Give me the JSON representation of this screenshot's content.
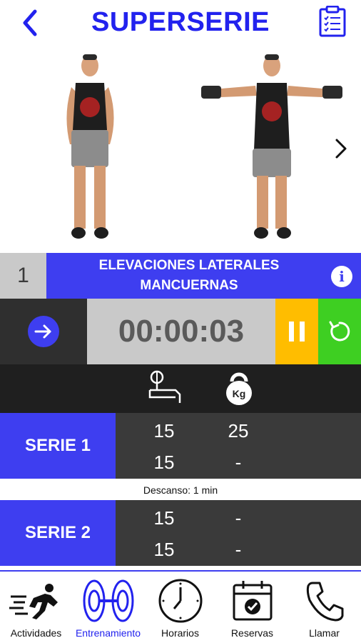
{
  "header": {
    "title": "SUPERSERIE",
    "back_icon": "chevron-left-icon",
    "clipboard_icon": "clipboard-list-icon"
  },
  "hero": {
    "next_icon": "chevron-right-icon"
  },
  "exercise": {
    "number": "1",
    "name": "ELEVACIONES LATERALES\nMANCUERNAS",
    "info_label": "i"
  },
  "timer": {
    "value": "00:00:03",
    "start_icon": "arrow-right-icon",
    "pause_icon": "pause-icon",
    "reset_icon": "reset-icon"
  },
  "columns": {
    "reps_icon": "bench-press-icon",
    "weight_icon": "kettlebell-icon",
    "weight_label": "Kg"
  },
  "series": [
    {
      "label": "SERIE 1",
      "rows": [
        {
          "reps": "15",
          "kg": "25"
        },
        {
          "reps": "15",
          "kg": "-"
        }
      ]
    },
    {
      "label": "SERIE 2",
      "rows": [
        {
          "reps": "15",
          "kg": "-"
        },
        {
          "reps": "15",
          "kg": "-"
        }
      ]
    }
  ],
  "rest": "Descanso: 1 min",
  "nav": [
    {
      "label": "Actividades",
      "icon": "runner-icon"
    },
    {
      "label": "Entrenamiento",
      "icon": "weight-plates-icon",
      "active": true
    },
    {
      "label": "Horarios",
      "icon": "clock-icon"
    },
    {
      "label": "Reservas",
      "icon": "calendar-check-icon"
    },
    {
      "label": "Llamar",
      "icon": "phone-icon"
    }
  ],
  "colors": {
    "primary": "#3e3ef0",
    "title": "#2222ee",
    "pause": "#ffbd00",
    "reset": "#3ecf22",
    "dark": "#2f2f2f"
  }
}
